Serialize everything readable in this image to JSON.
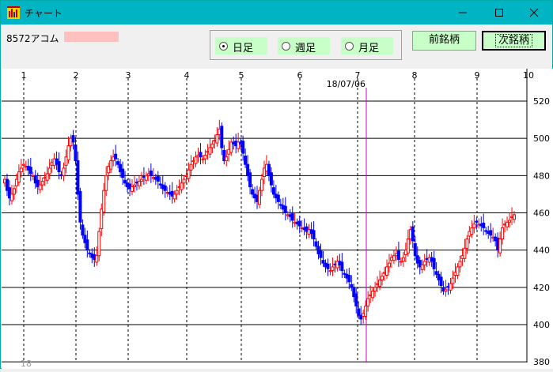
{
  "window": {
    "title": "チャート",
    "icon": "app-chart-icon",
    "controls": [
      "minimize-icon",
      "maximize-icon",
      "close-icon"
    ]
  },
  "toolbar": {
    "stock_label": "8572アコム",
    "periods": [
      {
        "label": "日足",
        "selected": true
      },
      {
        "label": "週足",
        "selected": false
      },
      {
        "label": "月足",
        "selected": false
      }
    ],
    "prev_button": "前銘柄",
    "next_button": "次銘柄"
  },
  "chart_data": {
    "type": "candlestick",
    "month_labels": [
      "1",
      "2",
      "3",
      "4",
      "5",
      "6",
      "7",
      "8",
      "9",
      "10"
    ],
    "year_label": "18",
    "date_marker": "18/07/06",
    "y_ticks": [
      380,
      400,
      420,
      440,
      460,
      480,
      500,
      520
    ],
    "ylim": [
      380,
      530
    ],
    "colors": {
      "up": "#ff0000",
      "down": "#0000ff",
      "marker": "#cc00cc"
    },
    "closes": [
      478,
      472,
      468,
      470,
      473,
      478,
      482,
      484,
      486,
      485,
      483,
      481,
      480,
      476,
      474,
      475,
      477,
      479,
      481,
      484,
      487,
      489,
      486,
      482,
      480,
      484,
      490,
      496,
      500,
      498,
      488,
      470,
      455,
      448,
      444,
      440,
      438,
      436,
      435,
      437,
      450,
      462,
      472,
      480,
      485,
      488,
      490,
      489,
      486,
      482,
      479,
      476,
      474,
      473,
      474,
      475,
      476,
      477,
      478,
      479,
      480,
      481,
      480,
      479,
      478,
      477,
      475,
      473,
      472,
      471,
      470,
      469,
      470,
      472,
      474,
      476,
      478,
      480,
      483,
      486,
      488,
      490,
      491,
      490,
      489,
      491,
      493,
      495,
      497,
      499,
      502,
      505,
      495,
      488,
      490,
      494,
      498,
      497,
      496,
      498,
      497,
      492,
      486,
      480,
      474,
      470,
      468,
      466,
      472,
      478,
      484,
      486,
      480,
      475,
      470,
      468,
      466,
      464,
      462,
      460,
      459,
      458,
      456,
      455,
      454,
      453,
      452,
      451,
      450,
      451,
      449,
      446,
      442,
      438,
      436,
      433,
      431,
      430,
      429,
      431,
      432,
      434,
      432,
      429,
      427,
      425,
      423,
      420,
      415,
      410,
      405,
      403,
      406,
      410,
      414,
      416,
      418,
      420,
      422,
      424,
      426,
      428,
      431,
      433,
      436,
      437,
      438,
      435,
      434,
      436,
      440,
      446,
      451,
      445,
      437,
      433,
      431,
      432,
      434,
      435,
      436,
      434,
      430,
      427,
      424,
      421,
      418,
      419,
      420,
      422,
      425,
      428,
      431,
      434,
      437,
      441,
      446,
      450,
      452,
      454,
      455,
      454,
      453,
      452,
      450,
      449,
      448,
      447,
      445,
      440,
      446,
      452,
      454,
      455,
      456,
      458,
      459
    ]
  }
}
